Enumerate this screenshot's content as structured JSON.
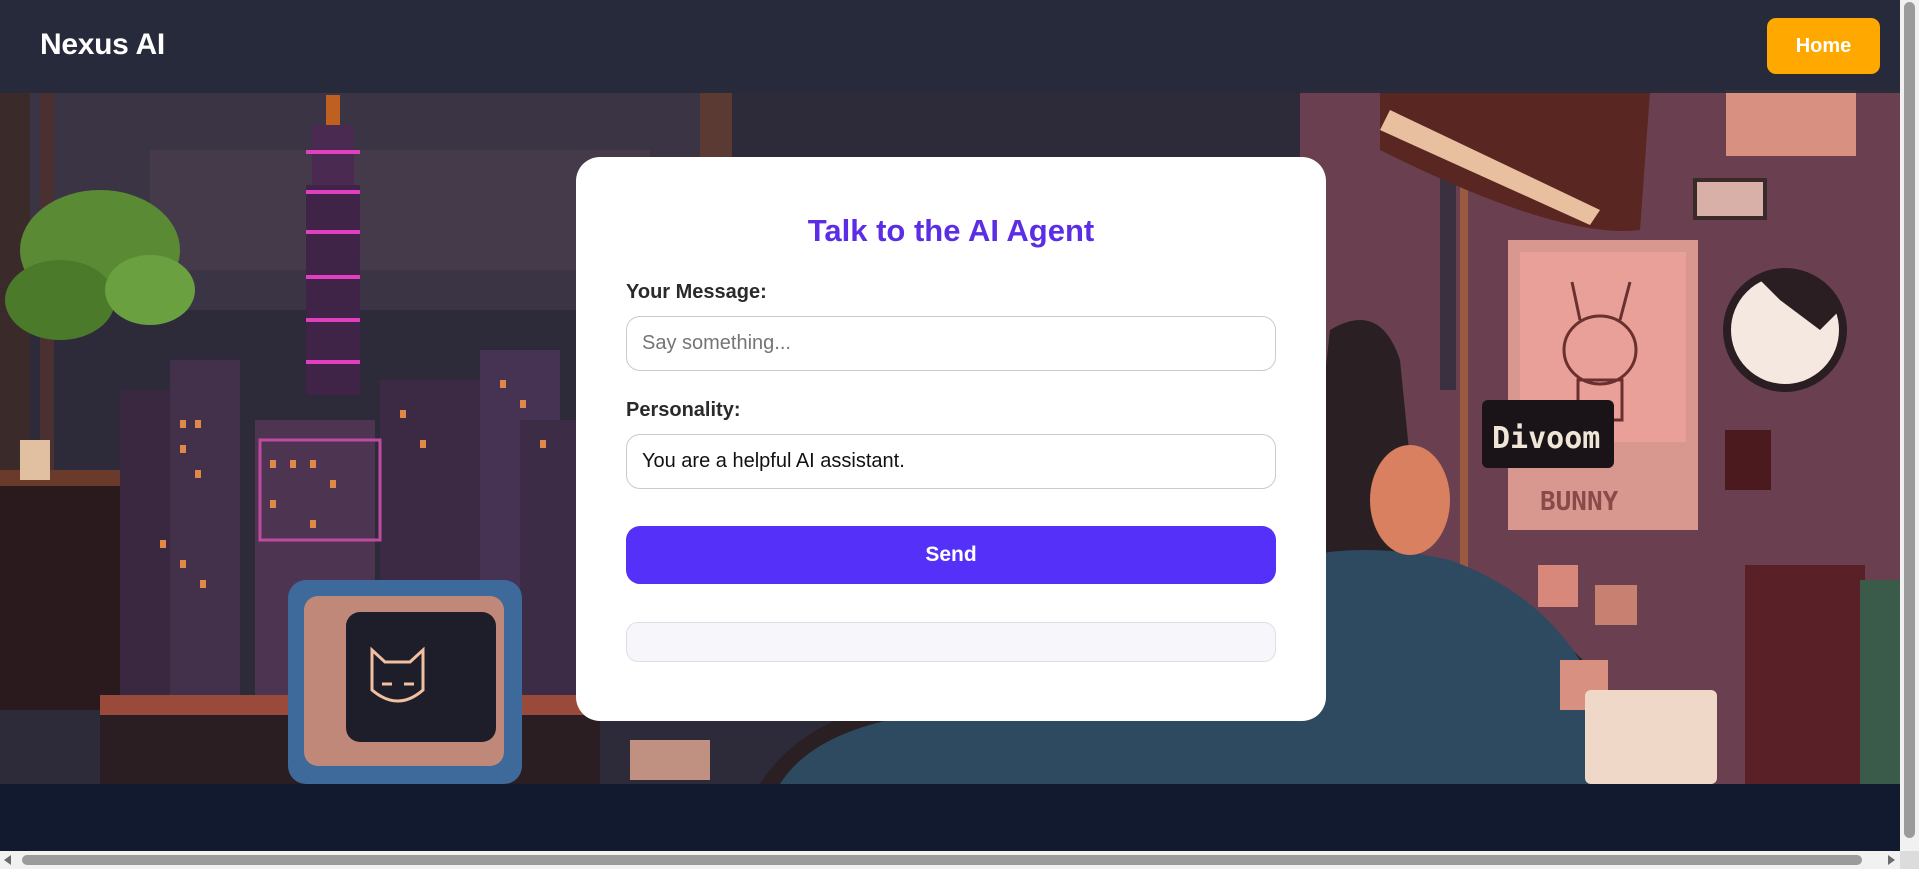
{
  "header": {
    "brand": "Nexus AI",
    "home_label": "Home"
  },
  "form": {
    "title": "Talk to the AI Agent",
    "message_label": "Your Message:",
    "message_placeholder": "Say something...",
    "message_value": "",
    "personality_label": "Personality:",
    "personality_value": "You are a helpful AI assistant.",
    "send_label": "Send",
    "response_text": ""
  },
  "background": {
    "poster_text": "BUNNY",
    "sign_text": "Divoom"
  },
  "colors": {
    "accent": "#5530f8",
    "title": "#5b2ee6",
    "home_button": "#ffa800",
    "header_bg": "#262a3a",
    "footer_bg": "#111a2e"
  }
}
